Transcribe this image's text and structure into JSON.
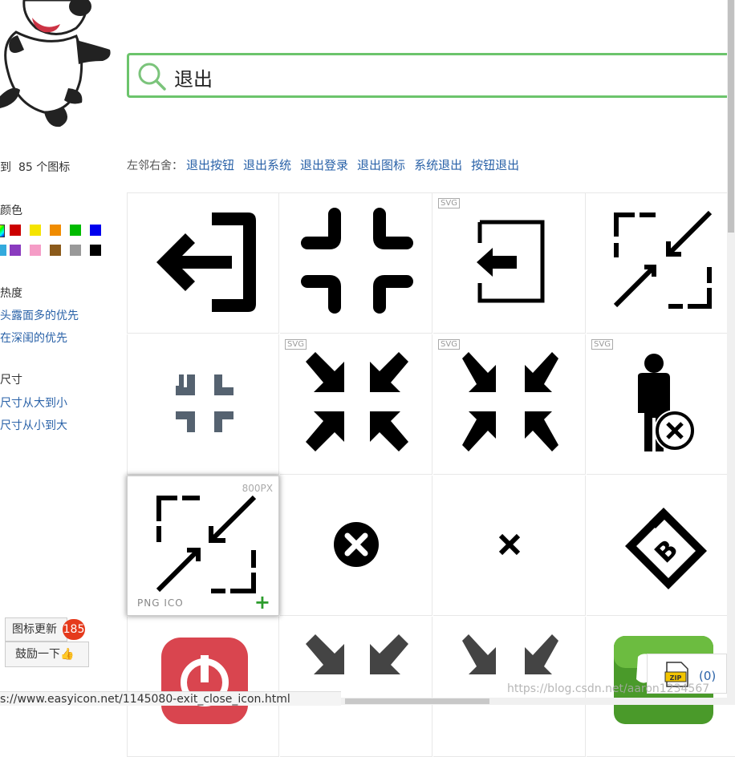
{
  "search": {
    "value": "退出"
  },
  "sidebar": {
    "count_prefix": "到",
    "count_value": "85 个图标",
    "color_heading": "颜色",
    "colors": [
      "#cc0000",
      "#f5e400",
      "#f08c00",
      "#00bb00",
      "#0000ee",
      "#33aadd",
      "#8a3bbf",
      "#f59cc6",
      "#8b5a1b",
      "#999999",
      "#000000"
    ],
    "heat_heading": "热度",
    "heat_options": [
      "头露面多的优先",
      "在深闺的优先"
    ],
    "size_heading": "尺寸",
    "size_options": [
      "尺寸从大到小",
      "尺寸从小到大"
    ]
  },
  "related": {
    "label": "左邻右舍：",
    "links": [
      "退出按钮",
      "退出系统",
      "退出登录",
      "退出图标",
      "系统退出",
      "按钮退出"
    ]
  },
  "grid": {
    "svg_tag": "SVG",
    "hover_size": "800PX",
    "hover_formats": "PNG  ICO",
    "hover_add": "+",
    "icons": [
      {
        "name": "exit-door-arrow-icon",
        "svg": false
      },
      {
        "name": "compress-corners-icon",
        "svg": false
      },
      {
        "name": "login-door-outline-icon",
        "svg": true
      },
      {
        "name": "exit-fullscreen-dashed-icon",
        "svg": false
      },
      {
        "name": "compress-small-gray-icon",
        "svg": false
      },
      {
        "name": "compress-arrows-bold-icon",
        "svg": true
      },
      {
        "name": "compress-arrows-thin-icon",
        "svg": true
      },
      {
        "name": "user-remove-icon",
        "svg": true
      },
      {
        "name": "exit-fullscreen-dashed-hover-icon",
        "svg": false
      },
      {
        "name": "close-circle-icon",
        "svg": false
      },
      {
        "name": "close-x-icon",
        "svg": false
      },
      {
        "name": "bitcoin-ticket-icon",
        "svg": false
      },
      {
        "name": "power-app-icon",
        "svg": false
      },
      {
        "name": "compress-arrows-gray-icon",
        "svg": false
      },
      {
        "name": "compress-arrows-gray-thin-icon",
        "svg": false
      },
      {
        "name": "green-app-icon",
        "svg": false
      }
    ]
  },
  "bottom": {
    "update_label": "图标更新",
    "update_badge": "185",
    "encourage_label": "鼓励一下👍",
    "zip_count": "(0)",
    "status_url": "s://www.easyicon.net/1145080-exit_close_icon.html",
    "watermark": "https://blog.csdn.net/aaron1234567"
  }
}
